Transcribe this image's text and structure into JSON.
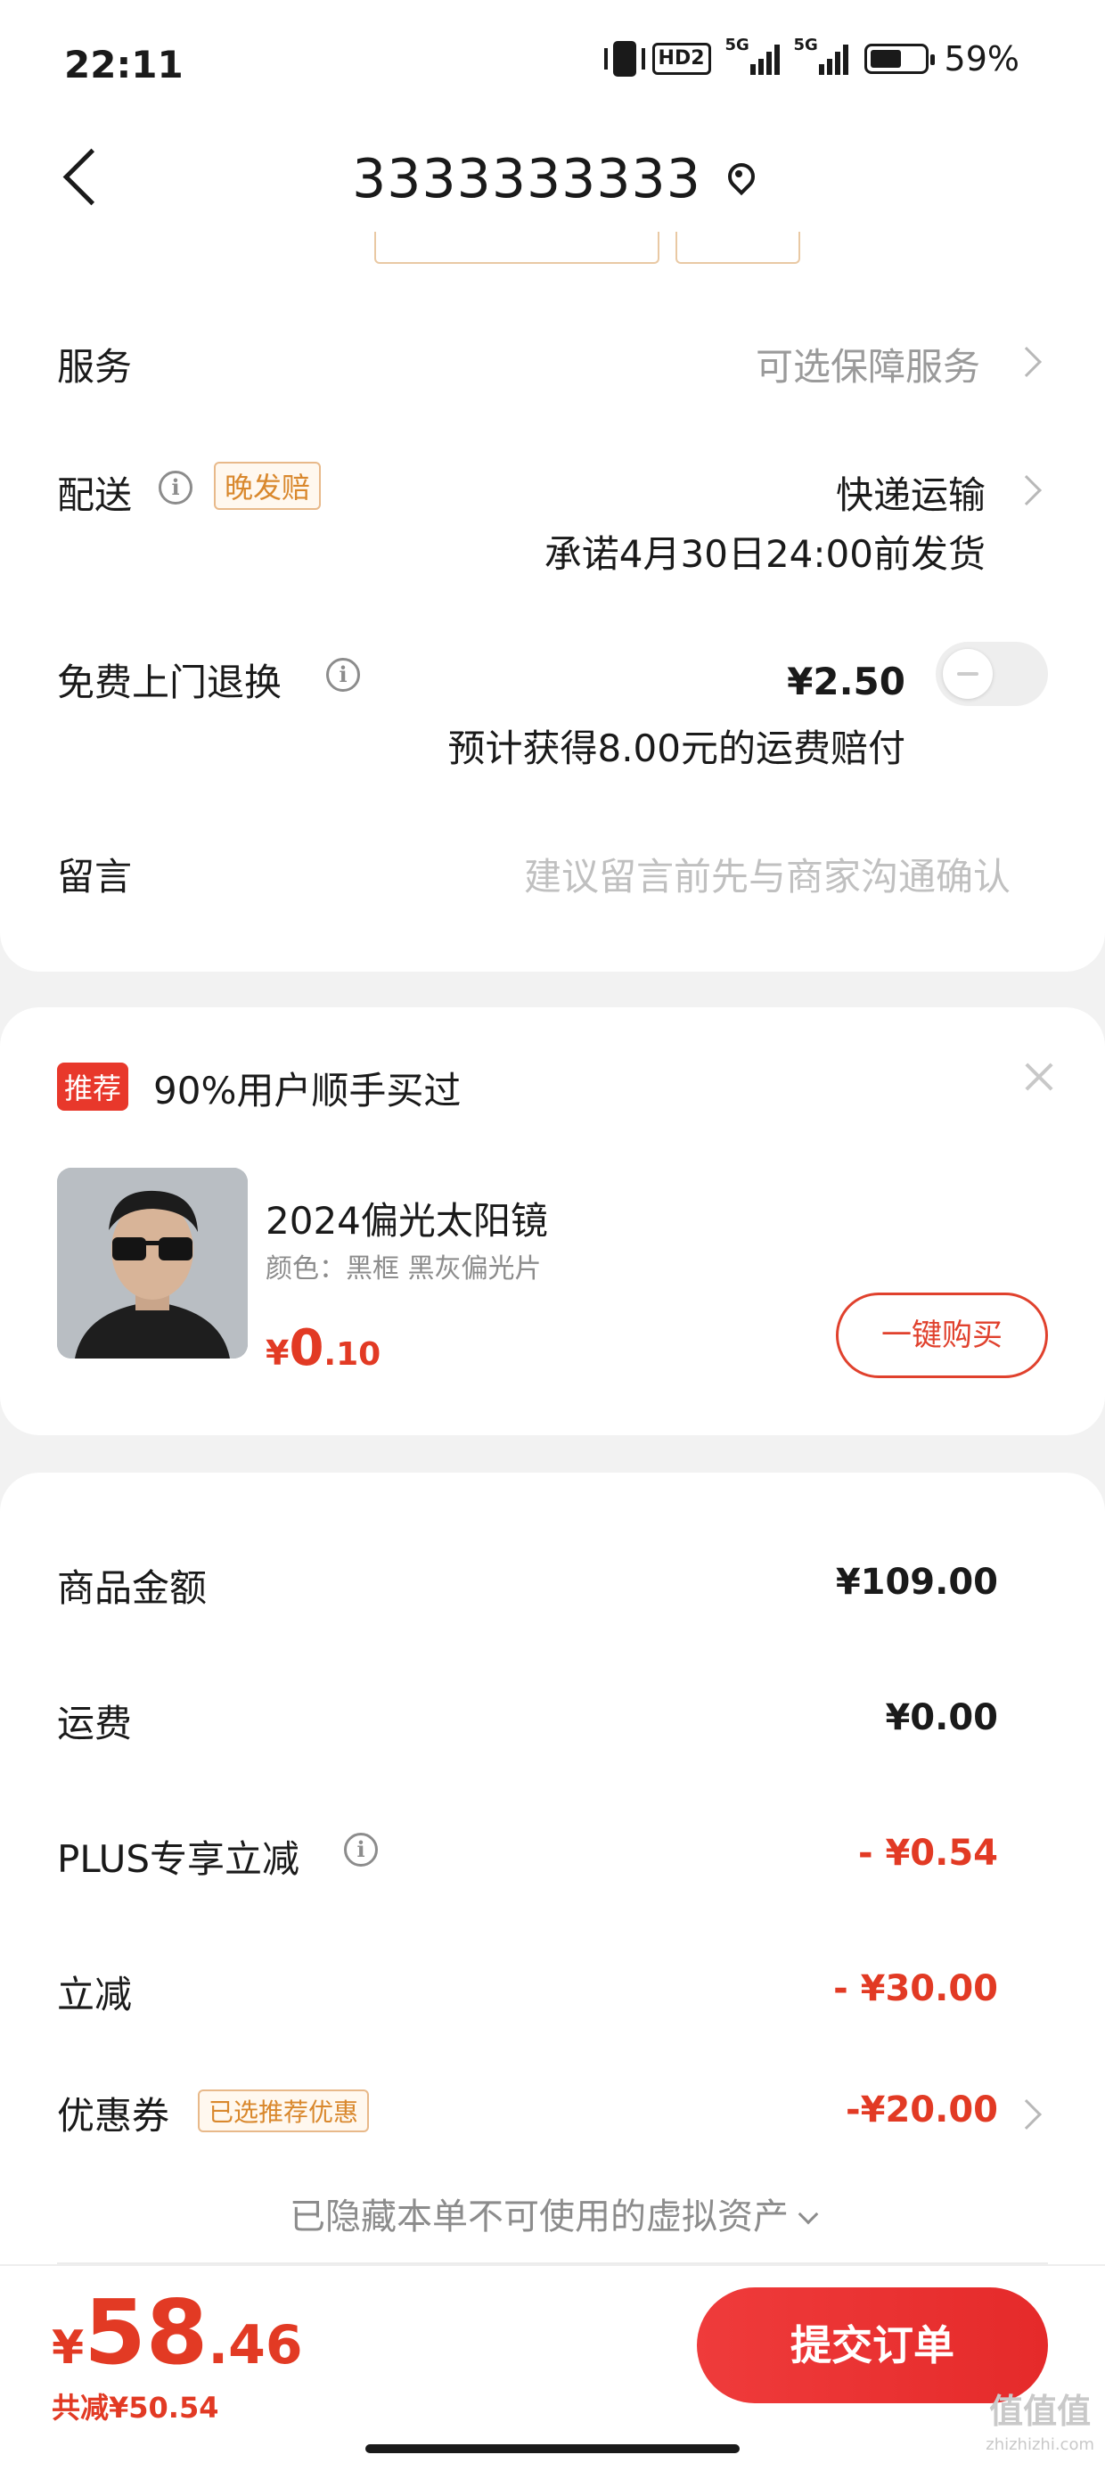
{
  "status_bar": {
    "time": "22:11",
    "hd_label": "HD2",
    "signal1_label": "5G",
    "signal2_label": "5G",
    "battery_percent": "59%",
    "battery_level": 0.59
  },
  "header": {
    "title": "3333333333"
  },
  "service_row": {
    "label": "服务",
    "value": "可选保障服务"
  },
  "delivery_row": {
    "label": "配送",
    "tag": "晚发赔",
    "method": "快递运输",
    "promise": "承诺4月30日24:00前发货"
  },
  "return_row": {
    "label": "免费上门退换",
    "price": "¥2.50",
    "note": "预计获得8.00元的运费赔付",
    "enabled": false
  },
  "message_row": {
    "label": "留言",
    "placeholder": "建议留言前先与商家沟通确认"
  },
  "recommend": {
    "badge": "推荐",
    "title": "90%用户顺手买过",
    "product_name": "2024偏光太阳镜",
    "product_spec": "颜色：黑框 黑灰偏光片",
    "price_currency": "¥",
    "price_int": "0",
    "price_dec": ".10",
    "buy_button": "一键购买"
  },
  "summary": {
    "goods_label": "商品金额",
    "goods_value": "¥109.00",
    "shipping_label": "运费",
    "shipping_value": "¥0.00",
    "plus_label": "PLUS专享立减",
    "plus_value": "- ¥0.54",
    "discount_label": "立减",
    "discount_value": "- ¥30.00",
    "coupon_label": "优惠券",
    "coupon_tag": "已选推荐优惠",
    "coupon_value": "-¥20.00",
    "hidden_note": "已隐藏本单不可使用的虚拟资产"
  },
  "bottom_bar": {
    "total_currency": "¥",
    "total_int": "58",
    "total_dec": ".46",
    "saved": "共减¥50.54",
    "submit": "提交订单"
  },
  "watermark": {
    "text": "值值值",
    "sub": "zhizhizhi.com"
  },
  "colors": {
    "accent_red": "#e23a24",
    "tag_orange": "#d9882d",
    "background": "#f2f2f2"
  }
}
